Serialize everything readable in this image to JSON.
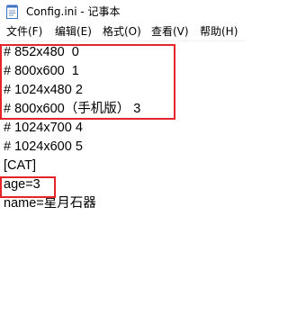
{
  "window": {
    "title": "Config.ini - 记事本"
  },
  "menu": {
    "items": [
      {
        "label": "文件(F)"
      },
      {
        "label": "编辑(E)"
      },
      {
        "label": "格式(O)"
      },
      {
        "label": "查看(V)"
      },
      {
        "label": "帮助(H)"
      }
    ]
  },
  "editor": {
    "lines": [
      "# 852x480  0",
      "# 800x600  1",
      "# 1024x480 2",
      "# 800x600（手机版） 3",
      "# 1024x700 4",
      "# 1024x600 5",
      "[CAT]",
      "age=3",
      "name=星月石器"
    ]
  },
  "annotations": {
    "highlight_color": "#e8232a"
  }
}
